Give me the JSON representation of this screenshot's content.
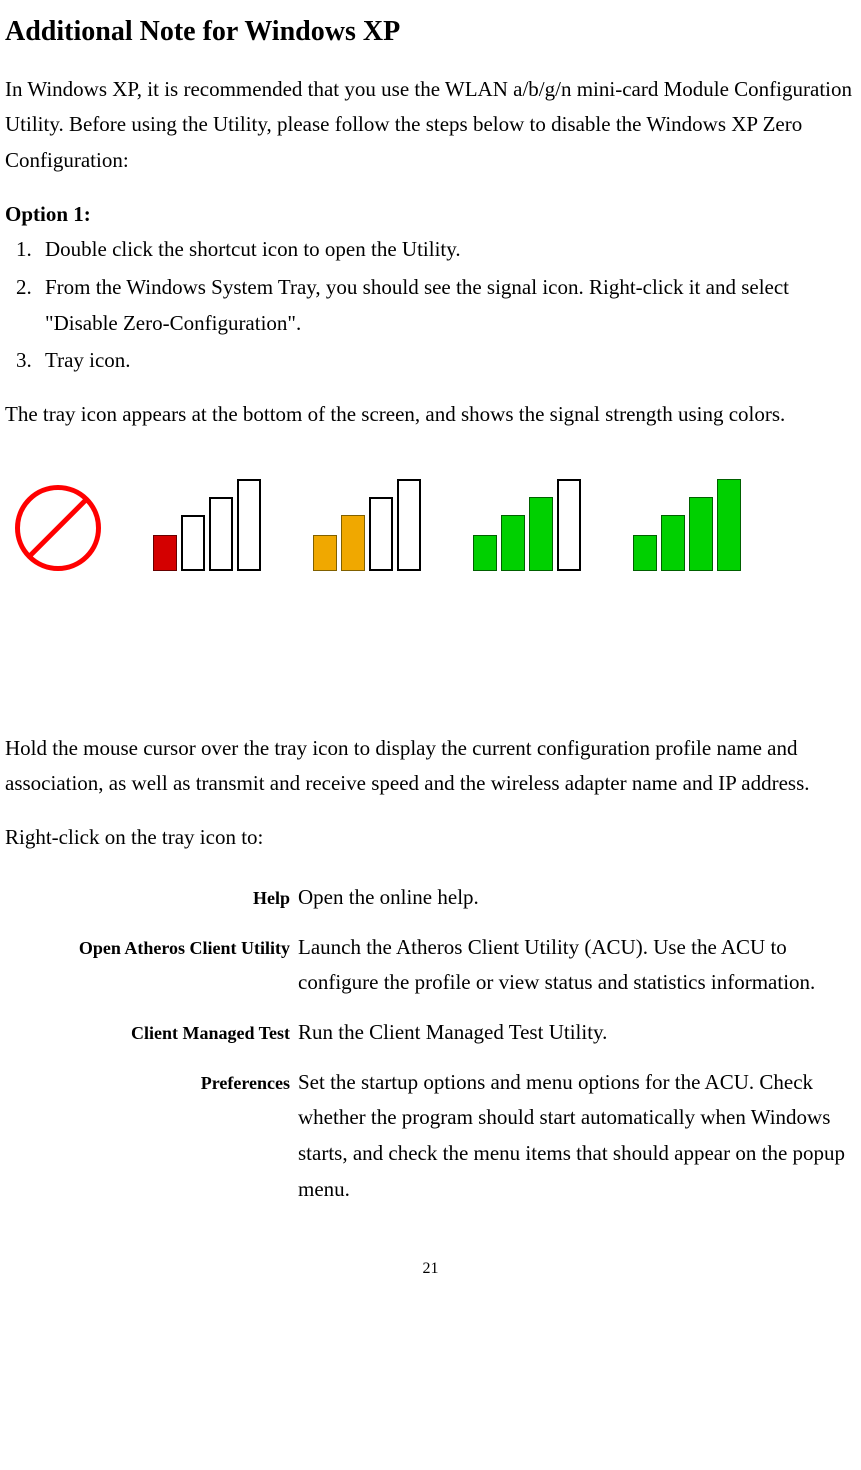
{
  "heading": "Additional Note for Windows XP",
  "intro": "In Windows XP, it is recommended that you use the WLAN a/b/g/n mini-card Module Configuration Utility.    Before using the Utility, please follow the steps below to disable the Windows XP Zero Configuration:",
  "option1_label": "Option 1:",
  "steps": [
    "Double click the shortcut icon to open the Utility.",
    "From the Windows System Tray, you should see the signal icon.    Right-click it and select \"Disable Zero-Configuration\".",
    "Tray icon."
  ],
  "tray_desc": "The tray icon appears at the bottom of the screen, and shows the signal strength using colors.",
  "signal_levels": [
    {
      "type": "none"
    },
    {
      "type": "bars",
      "filled": 1,
      "color": "red"
    },
    {
      "type": "bars",
      "filled": 2,
      "color": "orange"
    },
    {
      "type": "bars",
      "filled": 3,
      "color": "green"
    },
    {
      "type": "bars",
      "filled": 4,
      "color": "green"
    }
  ],
  "hover_desc": "Hold the mouse cursor over the tray icon to display the current configuration profile name and association, as well as transmit and receive speed and the wireless adapter name and IP address.",
  "rightclick_intro": "Right-click on the tray icon to:",
  "menu": [
    {
      "label": "Help",
      "desc": "Open the online help."
    },
    {
      "label": "Open Atheros Client Utility",
      "desc": "Launch the Atheros Client Utility (ACU).   Use the ACU to configure the profile or view status and statistics information."
    },
    {
      "label": "Client Managed Test",
      "desc": "Run the Client Managed Test Utility."
    },
    {
      "label": "Preferences",
      "desc": "Set the startup options and menu options for the ACU.   Check whether the program should start automatically when Windows starts, and check the menu items that should appear on the popup menu."
    }
  ],
  "page_number": "21"
}
